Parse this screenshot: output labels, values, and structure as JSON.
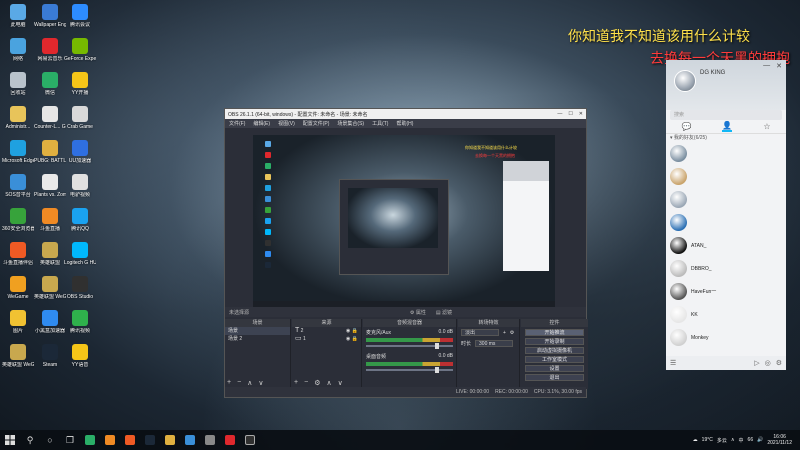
{
  "desktop": {
    "icons": [
      {
        "label": "此电脑",
        "color": "#5aa9e6"
      },
      {
        "label": "Wallpaper Engine:...",
        "color": "#3a7bd5"
      },
      {
        "label": "腾讯会议",
        "color": "#2d8cff"
      },
      {
        "label": "网络",
        "color": "#4aa3df"
      },
      {
        "label": "网易云音乐",
        "color": "#e0282d"
      },
      {
        "label": "GeForce Experience",
        "color": "#76b900"
      },
      {
        "label": "回收站",
        "color": "#b9c3cc"
      },
      {
        "label": "微信",
        "color": "#2aae67"
      },
      {
        "label": "YY开播",
        "color": "#f5c518"
      },
      {
        "label": "Administr...",
        "color": "#e8c45a"
      },
      {
        "label": "Counter-L... Global Off...",
        "color": "#e6e6e6"
      },
      {
        "label": "Crab Game",
        "color": "#d9d9d9"
      },
      {
        "label": "Microsoft Edge",
        "color": "#1fa1e0"
      },
      {
        "label": "PUBG: BATTLEGR...",
        "color": "#e0b040"
      },
      {
        "label": "UU加速器",
        "color": "#2f6fe0"
      },
      {
        "label": "SOS音平台",
        "color": "#3a8fd8"
      },
      {
        "label": "Plants vs. Zombies G...",
        "color": "#e9e9e9"
      },
      {
        "label": "电驴视频",
        "color": "#e0e0e0"
      },
      {
        "label": "360安全浏览器",
        "color": "#37a33b"
      },
      {
        "label": "斗鱼直播",
        "color": "#f08a24"
      },
      {
        "label": "腾讯QQ",
        "color": "#1aa2f0"
      },
      {
        "label": "斗鱼直播伴侣",
        "color": "#f05a24"
      },
      {
        "label": "英雄联盟",
        "color": "#c8a84e"
      },
      {
        "label": "Logitech G HUB",
        "color": "#00b8fc"
      },
      {
        "label": "WeGame",
        "color": "#f0a020"
      },
      {
        "label": "英雄联盟 WeGame版",
        "color": "#c8a84e"
      },
      {
        "label": "OBS Studio",
        "color": "#303030"
      },
      {
        "label": "图片",
        "color": "#f1c232"
      },
      {
        "label": "小黑盒加速器",
        "color": "#2f8bf0"
      },
      {
        "label": "腾讯视频",
        "color": "#2fb14c"
      },
      {
        "label": "英雄联盟 WeGame版",
        "color": "#c8a84e"
      },
      {
        "label": "Steam",
        "color": "#1b2838"
      },
      {
        "label": "YY语音",
        "color": "#f5c518"
      }
    ]
  },
  "overlay_text": {
    "line1": "你知道我不知道该用什么计较",
    "line2": "去换每一个天黑的拥抱"
  },
  "obs": {
    "title": "OBS 26.1.1 (64-bit, windows) - 配置文件: 未命名 - 场景: 未命名",
    "menu": [
      "文件(F)",
      "编辑(E)",
      "视图(V)",
      "配置文件(P)",
      "场景集合(S)",
      "工具(T)",
      "帮助(H)"
    ],
    "preview_bar": {
      "left": "未选择源",
      "properties": "属性",
      "filters": "滤镜"
    },
    "preview_text1": "你知道我不知道该用什么计较",
    "preview_text2": "去换每一个天黑的拥抱",
    "scenes": {
      "header": "场景",
      "items": [
        "场景",
        "场景 2"
      ]
    },
    "sources": {
      "header": "来源",
      "items": [
        "2",
        "1"
      ]
    },
    "mixer": {
      "header": "音频混音器",
      "channels": [
        {
          "name": "麦克风/Aux",
          "db": "0.0 dB"
        },
        {
          "name": "桌面音频",
          "db": "0.0 dB"
        }
      ]
    },
    "transitions": {
      "header": "转场特效",
      "type": "淡出",
      "duration_label": "时长",
      "duration": "300 ms"
    },
    "controls": {
      "header": "控件",
      "buttons": [
        "开始推流",
        "开始录制",
        "启动虚拟摄像机",
        "工作室模式",
        "设置",
        "退出"
      ]
    },
    "status": {
      "live": "LIVE: 00:00:00",
      "rec": "REC: 00:00:00",
      "cpu": "CPU: 3.1%, 30.00 fps"
    }
  },
  "qq": {
    "nickname": "DG KING",
    "search_placeholder": "搜索",
    "group_label": "我的好友(6/25)",
    "friends": [
      {
        "name": "",
        "sig": "",
        "color": "#7a8ea0"
      },
      {
        "name": "",
        "sig": "",
        "color": "#c9a36b"
      },
      {
        "name": "",
        "sig": "",
        "color": "#9aa7b5"
      },
      {
        "name": "",
        "sig": "",
        "color": "#2a6fb4"
      },
      {
        "name": "ATAN_",
        "sig": "",
        "color": "#111111"
      },
      {
        "name": "DBBRO_",
        "sig": "",
        "color": "#bbbbbb"
      },
      {
        "name": "HaveFun一",
        "sig": "",
        "color": "#555555"
      },
      {
        "name": "KK",
        "sig": "",
        "color": "#e6e6e6"
      },
      {
        "name": "Monkey",
        "sig": "",
        "color": "#d0d0d0"
      }
    ]
  },
  "taskbar": {
    "temperature": "19°C",
    "weather": "多云",
    "lang": "中",
    "badge": "66",
    "time": "16:06",
    "date": "2021/11/12"
  }
}
